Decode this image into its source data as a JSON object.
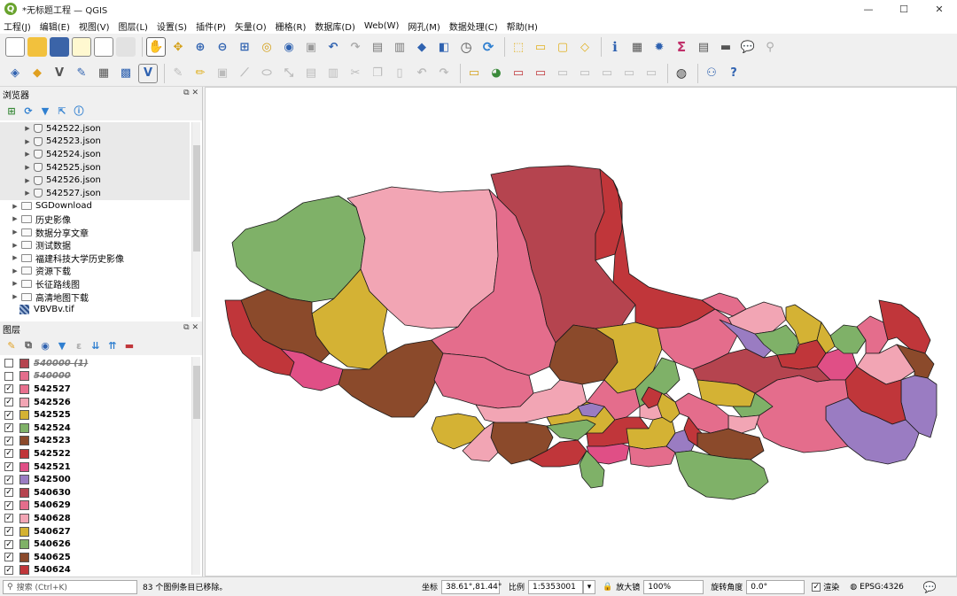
{
  "window": {
    "title": "*无标题工程 — QGIS",
    "minimize": "—",
    "maximize": "☐",
    "close": "✕"
  },
  "menu": [
    "工程(J)",
    "编辑(E)",
    "视图(V)",
    "图层(L)",
    "设置(S)",
    "插件(P)",
    "矢量(O)",
    "栅格(R)",
    "数据库(D)",
    "Web(W)",
    "网孔(M)",
    "数据处理(C)",
    "帮助(H)"
  ],
  "browser": {
    "title": "浏览器",
    "files": [
      "542522.json",
      "542523.json",
      "542524.json",
      "542525.json",
      "542526.json",
      "542527.json"
    ],
    "folders": [
      "SGDownload",
      "历史影像",
      "数据分享文章",
      "测试数据",
      "福建科技大学历史影像",
      "资源下载",
      "长征路线图",
      "高清地图下载"
    ],
    "raster": "VBVBv.tif"
  },
  "layers": {
    "title": "图层",
    "items": [
      {
        "name": "540000 (1)",
        "checked": false,
        "color": "#b5444f"
      },
      {
        "name": "540000",
        "checked": false,
        "color": "#e46d8c"
      },
      {
        "name": "542527",
        "checked": true,
        "color": "#e8708e"
      },
      {
        "name": "542526",
        "checked": true,
        "color": "#f2a5b4"
      },
      {
        "name": "542525",
        "checked": true,
        "color": "#d4b234"
      },
      {
        "name": "542524",
        "checked": true,
        "color": "#7fb168"
      },
      {
        "name": "542523",
        "checked": true,
        "color": "#8b4a2b"
      },
      {
        "name": "542522",
        "checked": true,
        "color": "#c0363a"
      },
      {
        "name": "542521",
        "checked": true,
        "color": "#e04f86"
      },
      {
        "name": "542500",
        "checked": true,
        "color": "#9a7cc2"
      },
      {
        "name": "540630",
        "checked": true,
        "color": "#b5444f"
      },
      {
        "name": "540629",
        "checked": true,
        "color": "#e46d8c"
      },
      {
        "name": "540628",
        "checked": true,
        "color": "#f2a5b4"
      },
      {
        "name": "540627",
        "checked": true,
        "color": "#d4b234"
      },
      {
        "name": "540626",
        "checked": true,
        "color": "#7fb168"
      },
      {
        "name": "540625",
        "checked": true,
        "color": "#8b4a2b"
      },
      {
        "name": "540624",
        "checked": true,
        "color": "#c0363a"
      }
    ]
  },
  "status": {
    "search_placeholder": "搜索 (Ctrl+K)",
    "message": "83 个图例条目已移除。",
    "coord_label": "坐标",
    "coord_value": "38.61°,81.44°",
    "scale_label": "比例",
    "scale_value": "1:5353001",
    "magnifier_label": "放大镜",
    "magnifier_value": "100%",
    "rotation_label": "旋转角度",
    "rotation_value": "0.0°",
    "render_label": "渲染",
    "crs": "EPSG:4326"
  },
  "palette": {
    "dark_red": "#b5444f",
    "pink": "#e46d8c",
    "light_pink": "#f2a5b4",
    "yellow": "#d4b234",
    "green": "#7fb168",
    "brown": "#8b4a2b",
    "red": "#c0363a",
    "magenta": "#e04f86",
    "purple": "#9a7cc2"
  }
}
